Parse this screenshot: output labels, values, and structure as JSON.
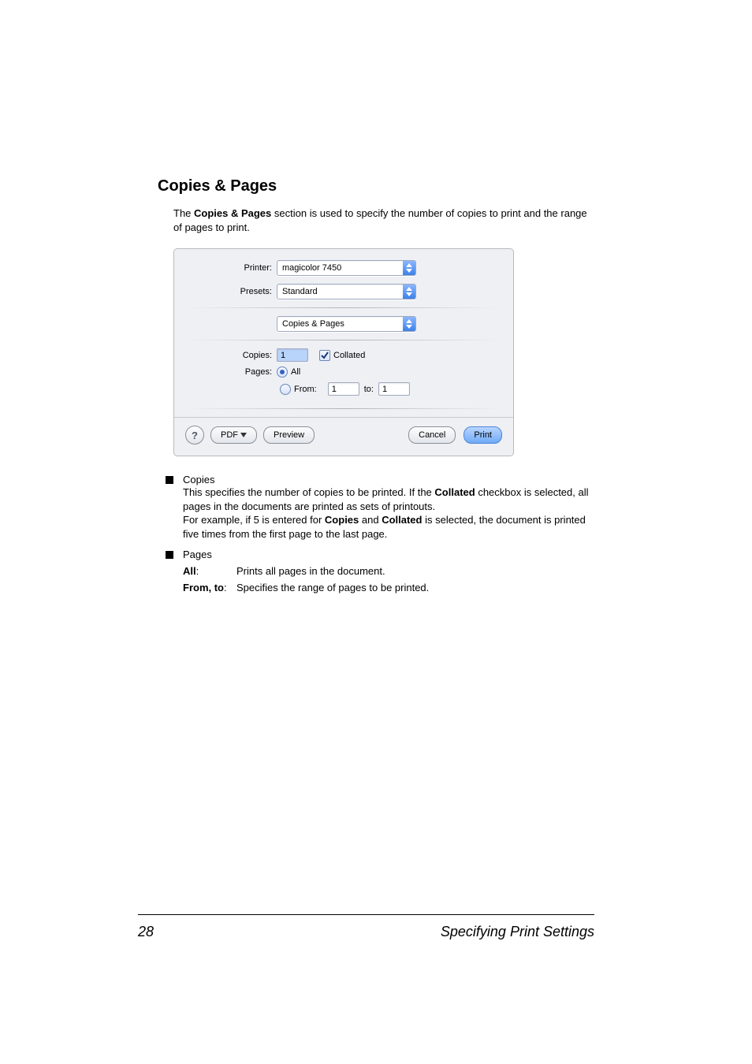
{
  "section_title": "Copies & Pages",
  "intro_pre": "The ",
  "intro_bold": "Copies & Pages",
  "intro_post": " section is used to specify the number of copies to print and the range of pages to print.",
  "dialog": {
    "printer_label": "Printer:",
    "printer_value": "magicolor 7450",
    "presets_label": "Presets:",
    "presets_value": "Standard",
    "panel_value": "Copies & Pages",
    "copies_label": "Copies:",
    "copies_value": "1",
    "collated_label": "Collated",
    "pages_label": "Pages:",
    "pages_all": "All",
    "pages_from": "From:",
    "from_value": "1",
    "to_label": "to:",
    "to_value": "1",
    "help_glyph": "?",
    "pdf_btn": "PDF",
    "preview_btn": "Preview",
    "cancel_btn": "Cancel",
    "print_btn": "Print"
  },
  "list": {
    "copies_heading": "Copies",
    "copies_p1a": "This specifies the number of copies to be printed. If the ",
    "copies_p1b": "Collated",
    "copies_p1c": " checkbox is selected, all pages in the documents are printed as sets of printouts.",
    "copies_p2a": "For example, if 5 is entered for ",
    "copies_p2b": "Copies",
    "copies_p2c": " and ",
    "copies_p2d": "Collated",
    "copies_p2e": " is selected, the document is printed five times from the first page to the last page.",
    "pages_heading": "Pages",
    "all_key": "All",
    "all_desc": "Prints all pages in the document.",
    "fromto_key": "From, to",
    "fromto_desc": "Specifies the range of pages to be printed."
  },
  "page_number": "28",
  "footer_title": "Specifying Print Settings"
}
